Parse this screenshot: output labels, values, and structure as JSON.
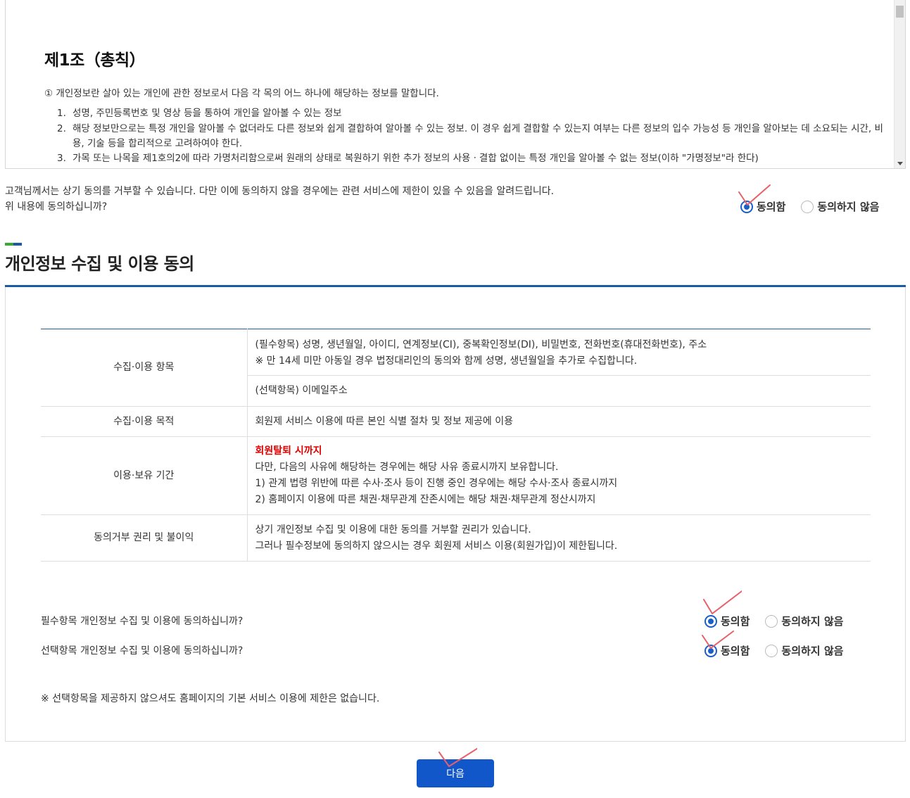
{
  "terms": {
    "title": "제1조（총칙）",
    "intro": "① 개인정보란 살아 있는 개인에 관한 정보로서 다음 각 목의 어느 하나에 해당하는 정보를 말합니다.",
    "items": [
      {
        "num": "1.",
        "text": "성명, 주민등록번호 및 영상 등을 통하여 개인을 알아볼 수 있는 정보"
      },
      {
        "num": "2.",
        "text": "해당 정보만으로는 특정 개인을 알아볼 수 없더라도 다른 정보와 쉽게 결합하여 알아볼 수 있는 정보. 이 경우 쉽게 결합할 수 있는지 여부는 다른 정보의 입수 가능성 등 개인을 알아보는 데 소요되는 시간, 비용, 기술 등을 합리적으로 고려하여야 한다."
      },
      {
        "num": "3.",
        "text": "가목 또는 나목을 제1호의2에 따라 가명처리함으로써 원래의 상태로 복원하기 위한 추가 정보의 사용ㆍ결합 없이는 특정 개인을 알아볼 수 없는 정보(이하 \"가명정보\"라 한다)"
      }
    ]
  },
  "consent1": {
    "line1": "고객님께서는 상기 동의를 거부할 수 있습니다. 다만 이에 동의하지 않을 경우에는 관련 서비스에 제한이 있을 수 있음을 알려드립니다.",
    "line2": "위 내용에 동의하십니까?",
    "agree": "동의함",
    "disagree": "동의하지 않음"
  },
  "section": {
    "title": "개인정보 수집 및 이용 동의",
    "bar_colors": [
      "#3aaa35",
      "#1a5aa6"
    ]
  },
  "table": {
    "rows": [
      {
        "header": "수집·이용 항목",
        "cells": [
          [
            "(필수항목) 성명, 생년월일, 아이디, 연계정보(CI), 중복확인정보(DI), 비밀번호, 전화번호(휴대전화번호), 주소",
            "※ 만 14세 미만 아동일 경우 법정대리인의 동의와 함께 성명, 생년월일을 추가로 수집합니다."
          ],
          [
            "(선택항목) 이메일주소"
          ]
        ]
      },
      {
        "header": "수집·이용 목적",
        "lines": [
          "회원제 서비스 이용에 따른 본인 식별 절차 및 정보 제공에 이용"
        ]
      },
      {
        "header": "이용·보유 기간",
        "highlight": "회원탈퇴 시까지",
        "lines": [
          "다만, 다음의 사유에 해당하는 경우에는 해당 사유 종료시까지 보유합니다.",
          "1) 관계 법령 위반에 따른 수사·조사 등이 진행 중인 경우에는 해당 수사·조사 종료시까지",
          "2) 홈페이지 이용에 따른 채권·채무관계 잔존시에는 해당 채권·채무관계 정산시까지"
        ]
      },
      {
        "header": "동의거부 권리 및 불이익",
        "lines": [
          "상기 개인정보 수집 및 이용에 대한 동의를 거부할 권리가 있습니다.",
          "그러나 필수정보에 동의하지 않으시는 경우 회원제 서비스 이용(회원가입)이 제한됩니다."
        ]
      }
    ]
  },
  "questions": {
    "required": "필수항목 개인정보 수집 및 이용에 동의하십니까?",
    "optional": "선택항목 개인정보 수집 및 이용에 동의하십니까?",
    "agree": "동의함",
    "disagree": "동의하지 않음"
  },
  "note": "※ 선택항목을 제공하지 않으셔도 홈페이지의 기본 서비스 이용에 제한은 없습니다.",
  "next_button": "다음",
  "colors": {
    "accent": "#1157c9",
    "mark": "#e8606a",
    "highlight": "#e00000"
  }
}
